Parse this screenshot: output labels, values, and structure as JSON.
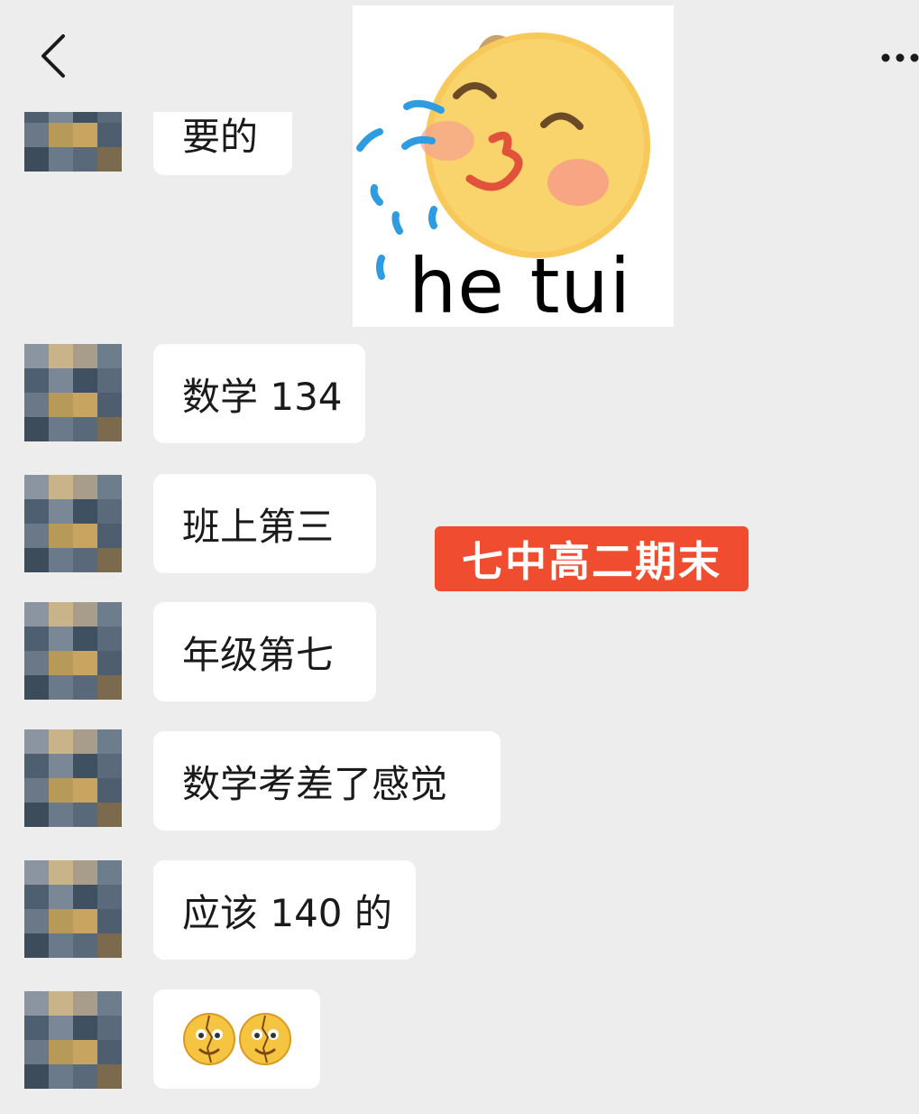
{
  "header": {
    "back_icon": "chevron-left-icon",
    "more_icon": "ellipsis-icon"
  },
  "messages": [
    {
      "text": "要的"
    },
    {
      "sticker": "blowing-kiss-face-icon",
      "caption": "he tui"
    },
    {
      "text": "数学 134"
    },
    {
      "text": "班上第三"
    },
    {
      "text": "年级第七"
    },
    {
      "text": "数学考差了感觉"
    },
    {
      "text": "应该 140 的"
    },
    {
      "emojis": [
        "cracked-smile-emoji",
        "cracked-smile-emoji"
      ]
    }
  ],
  "overlay_label": "七中高二期末",
  "colors": {
    "background": "#ededed",
    "bubble": "#ffffff",
    "label": "#ef4c30"
  }
}
